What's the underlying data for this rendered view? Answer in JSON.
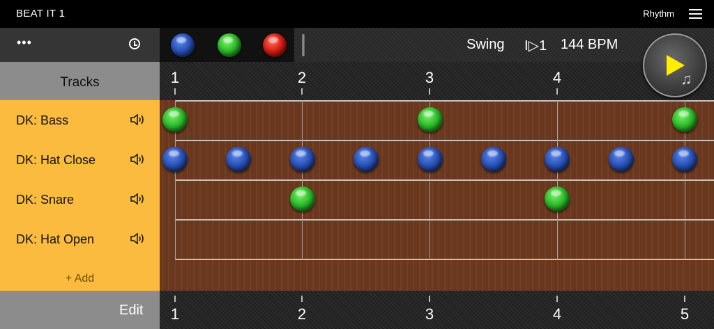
{
  "app": {
    "title": "BEAT IT 1",
    "mode": "Rhythm"
  },
  "toolbar": {
    "more": "•••",
    "swing": "Swing",
    "step": "I▷1",
    "bpm": "144 BPM"
  },
  "palette": [
    "blue",
    "green",
    "red"
  ],
  "colors": {
    "blue": "#2a52b8",
    "green": "#2dbb2a",
    "red": "#d81e14",
    "track_panel": "#fbbb3e"
  },
  "tracks_panel": {
    "header": "Tracks",
    "tracks": [
      {
        "label": "DK: Bass"
      },
      {
        "label": "DK: Hat Close"
      },
      {
        "label": "DK: Snare"
      },
      {
        "label": "DK: Hat Open"
      }
    ],
    "add_label": "+ Add",
    "edit_label": "Edit"
  },
  "ruler": {
    "top": [
      "1",
      "2",
      "3",
      "4"
    ],
    "bottom": [
      "1",
      "2",
      "3",
      "4",
      "5"
    ]
  },
  "pattern": [
    {
      "track": 0,
      "beats": [
        1,
        3,
        5
      ],
      "color": "green"
    },
    {
      "track": 1,
      "beats": [
        1,
        1.5,
        2,
        2.5,
        3,
        3.5,
        4,
        4.5,
        5
      ],
      "color": "blue"
    },
    {
      "track": 2,
      "beats": [
        2,
        4
      ],
      "color": "green"
    },
    {
      "track": 3,
      "beats": [],
      "color": "blue"
    }
  ]
}
